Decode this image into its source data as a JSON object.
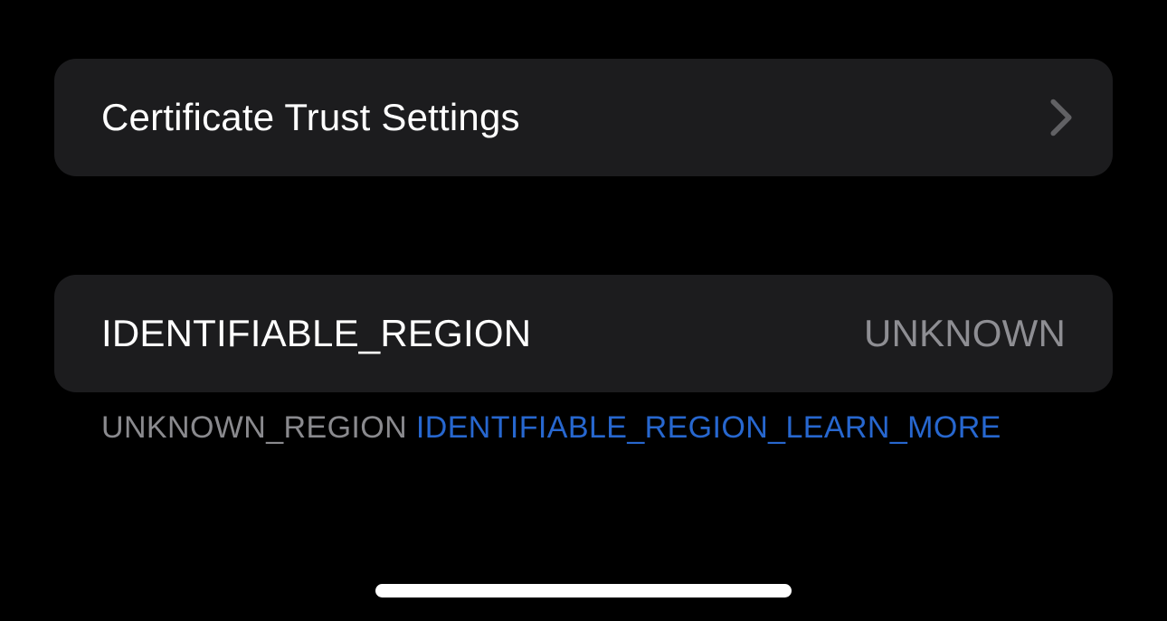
{
  "group1": {
    "cert_trust_label": "Certificate Trust Settings"
  },
  "group2": {
    "region_label": "IDENTIFIABLE_REGION",
    "region_value": "UNKNOWN"
  },
  "footer": {
    "plain": "UNKNOWN_REGION ",
    "link": "IDENTIFIABLE_REGION_LEARN_MORE"
  }
}
